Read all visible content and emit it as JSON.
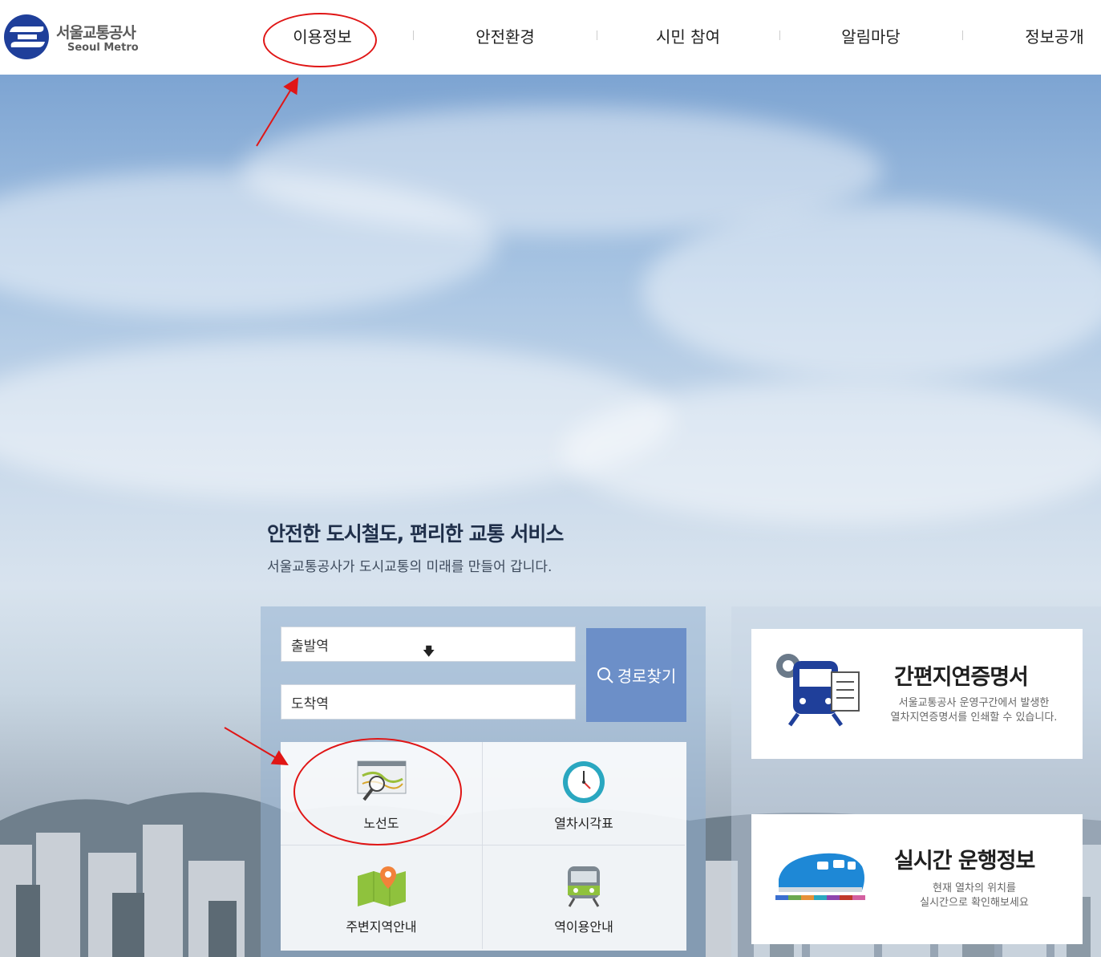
{
  "brand": {
    "name_ko": "서울교통공사",
    "name_en": "Seoul Metro",
    "logo_color": "#1f3f9a"
  },
  "nav": {
    "items": [
      {
        "label": "이용정보"
      },
      {
        "label": "안전환경"
      },
      {
        "label": "시민 참여"
      },
      {
        "label": "알림마당"
      },
      {
        "label": "정보공개"
      }
    ]
  },
  "hero": {
    "title": "안전한 도시철도, 편리한 교통 서비스",
    "subtitle": "서울교통공사가 도시교통의 미래를 만들어 갑니다."
  },
  "route_search": {
    "departure_value": "출발역",
    "arrival_value": "도착역",
    "button_label": "경로찾기",
    "accent": "#6c8fc8"
  },
  "quick_menu": [
    {
      "label": "노선도",
      "icon": "route-map-icon"
    },
    {
      "label": "열차시각표",
      "icon": "clock-icon"
    },
    {
      "label": "주변지역안내",
      "icon": "map-pin-icon"
    },
    {
      "label": "역이용안내",
      "icon": "train-icon"
    }
  ],
  "cards": [
    {
      "title": "간편지연증명서",
      "desc1": "서울교통공사 운영구간에서 발생한",
      "desc2": "열차지연증명서를 인쇄할 수 있습니다.",
      "icon": "delay-certificate-icon"
    },
    {
      "title": "실시간 운행정보",
      "desc1": "현재 열차의 위치를",
      "desc2": "실시간으로 확인해보세요",
      "icon": "bullet-train-icon"
    }
  ],
  "annotation_color": "#e01616"
}
